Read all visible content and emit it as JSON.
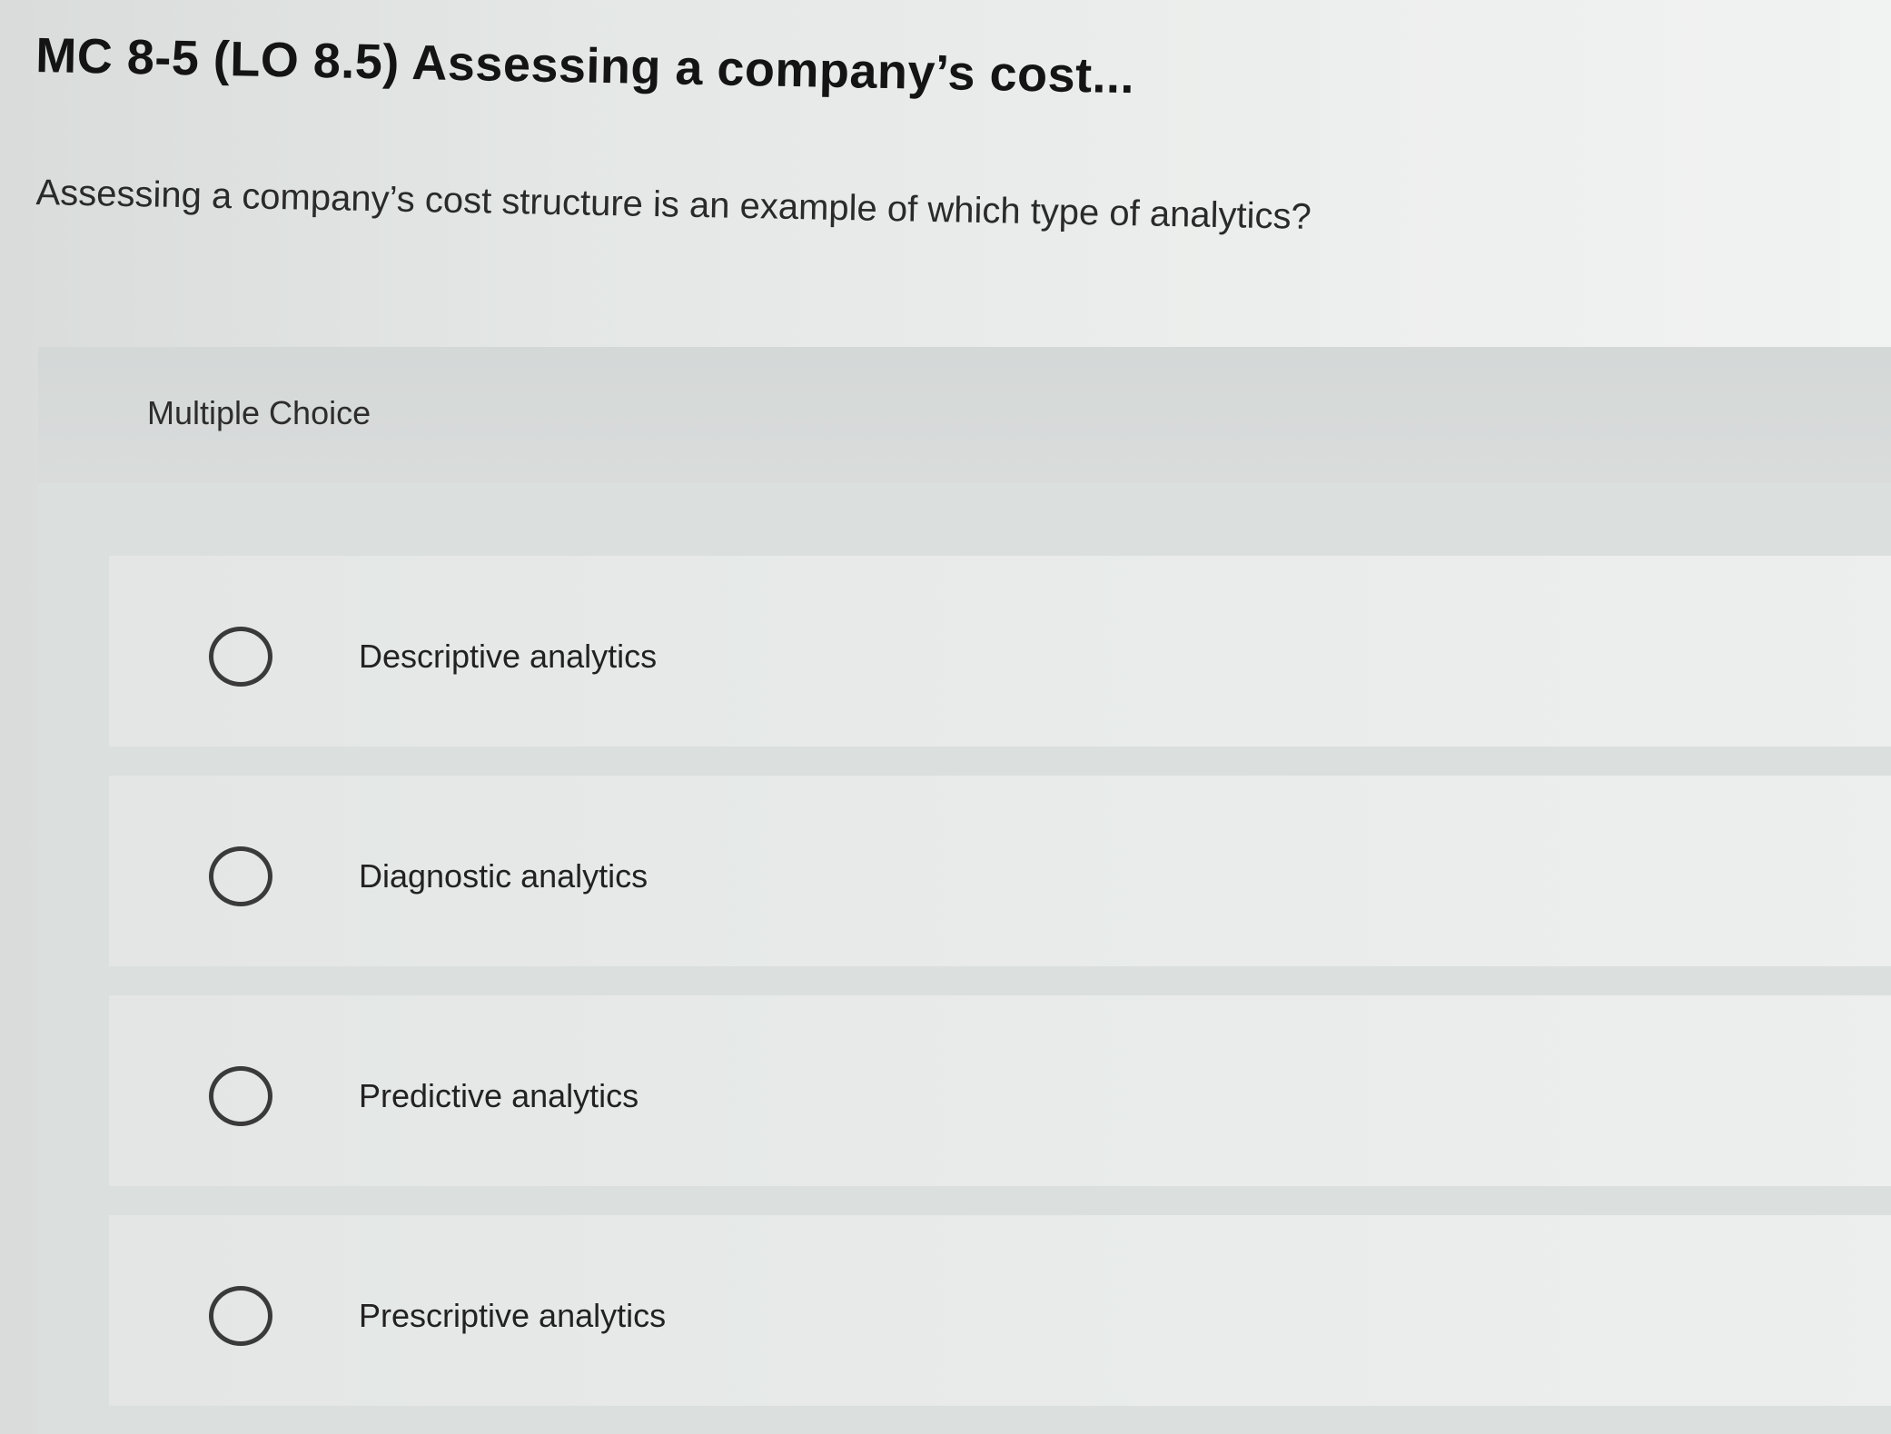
{
  "question": {
    "title": "MC 8-5 (LO 8.5) Assessing a company’s cost...",
    "text": "Assessing a company’s cost structure is an example of which type of analytics?"
  },
  "multiple_choice": {
    "label": "Multiple Choice",
    "options": [
      {
        "label": "Descriptive analytics"
      },
      {
        "label": "Diagnostic analytics"
      },
      {
        "label": "Predictive analytics"
      },
      {
        "label": "Prescriptive analytics"
      }
    ]
  }
}
